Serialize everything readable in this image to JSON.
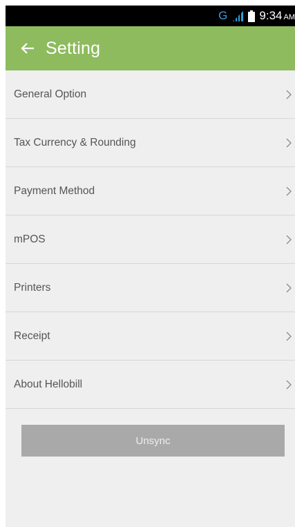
{
  "status_bar": {
    "network_type": "G",
    "icons": [
      "signal-icon",
      "battery-icon"
    ],
    "time": "9:34",
    "am_pm": "AM",
    "network_color": "#2f9fd9"
  },
  "app_bar": {
    "back_icon": "arrow-left-icon",
    "title": "Setting",
    "color": "#8dbb5e"
  },
  "settings": {
    "chevron_icon": "chevron-right-icon",
    "items": [
      {
        "label": "General Option"
      },
      {
        "label": "Tax Currency & Rounding"
      },
      {
        "label": "Payment Method"
      },
      {
        "label": "mPOS"
      },
      {
        "label": "Printers"
      },
      {
        "label": "Receipt"
      },
      {
        "label": "About Hellobill"
      }
    ]
  },
  "unsync_button": {
    "label": "Unsync",
    "color": "#a9a9a9"
  }
}
